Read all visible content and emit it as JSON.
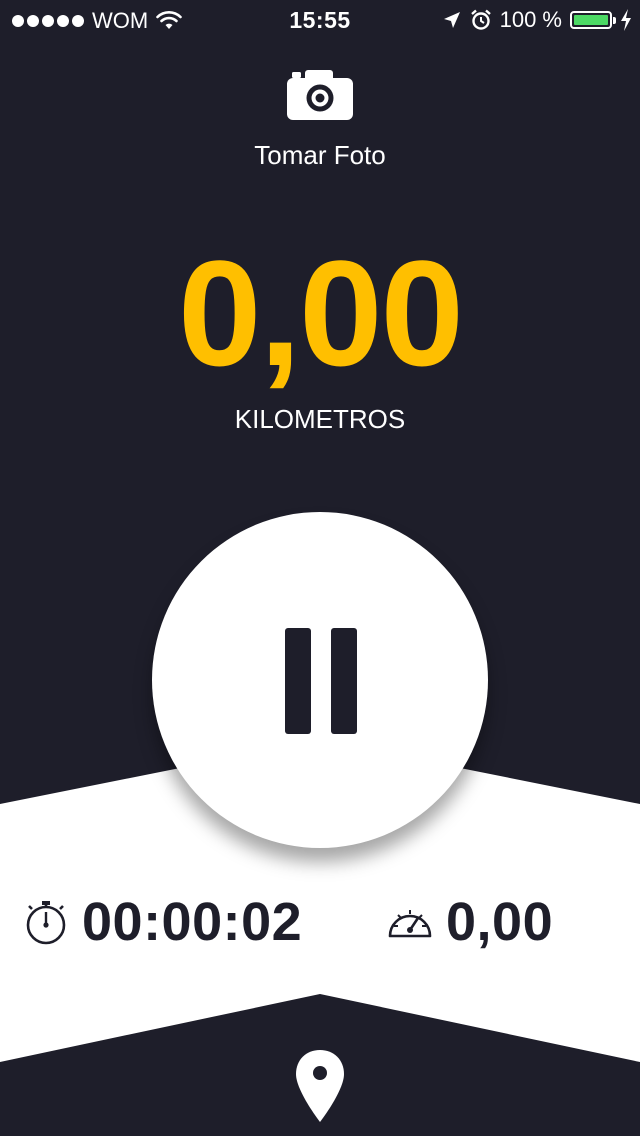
{
  "status_bar": {
    "carrier": "WOM",
    "time": "15:55",
    "battery": "100 %",
    "signal_bars": 5,
    "icons": [
      "signal-dots",
      "wifi-icon",
      "location-arrow-icon",
      "alarm-icon",
      "battery-icon",
      "charging-bolt-icon"
    ]
  },
  "photo": {
    "label": "Tomar Foto",
    "icon": "camera-icon"
  },
  "distance": {
    "value": "0,00",
    "unit": "KILOMETROS"
  },
  "control": {
    "icon": "pause-icon"
  },
  "stats": {
    "duration": "00:00:02",
    "duration_icon": "stopwatch-icon",
    "speed": "0,00",
    "speed_icon": "speedometer-icon"
  },
  "footer": {
    "icon": "map-pin-icon"
  },
  "colors": {
    "background": "#1e1e2a",
    "accent": "#ffbf00",
    "panel": "#ffffff",
    "battery": "#4cd964"
  }
}
